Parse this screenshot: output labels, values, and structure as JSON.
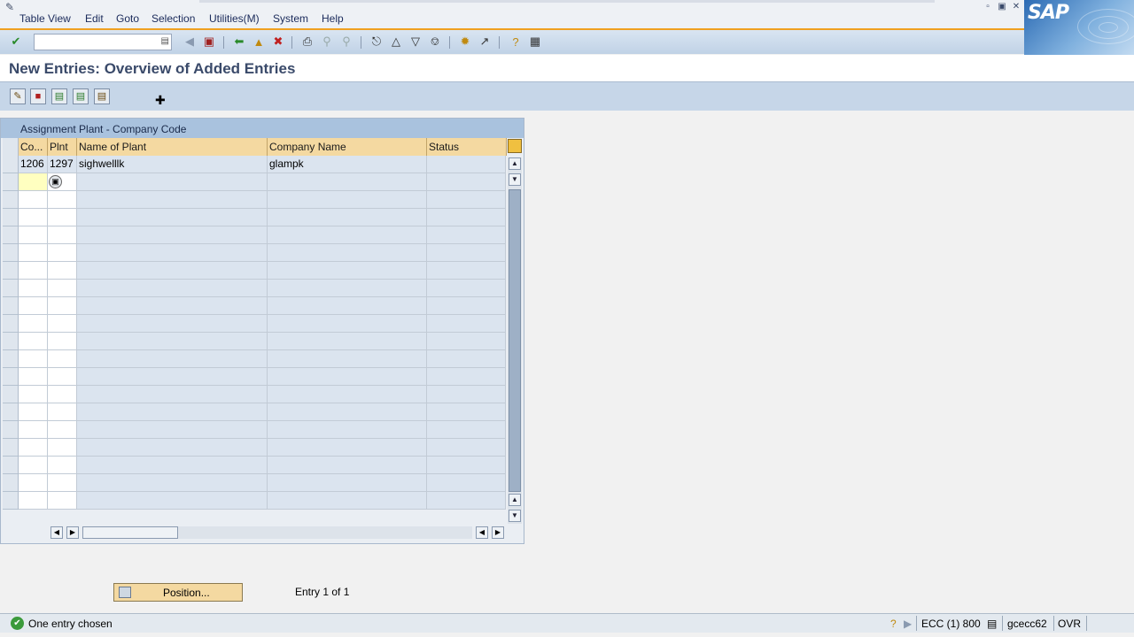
{
  "menu": {
    "items": [
      "Table View",
      "Edit",
      "Goto",
      "Selection",
      "Utilities(M)",
      "System",
      "Help"
    ]
  },
  "brand": {
    "logo_text": "SAP"
  },
  "toolbar": {
    "command_field_value": "",
    "icons": [
      "enter-icon",
      "back-icon",
      "exit-icon",
      "cancel-icon",
      "print-icon",
      "find-icon",
      "find-next-icon",
      "first-page-icon",
      "previous-page-icon",
      "next-page-icon",
      "last-page-icon",
      "create-session-icon",
      "shortcut-icon",
      "help-icon",
      "layout-icon"
    ]
  },
  "page": {
    "title": "New Entries: Overview of Added Entries"
  },
  "app_toolbar": {
    "icons": [
      "change-display-icon",
      "delete-icon",
      "previous-entry-icon",
      "next-entry-icon",
      "select-all-icon"
    ]
  },
  "table": {
    "title": "Assignment Plant - Company Code",
    "columns": [
      "Co...",
      "Plnt",
      "Name of Plant",
      "Company Name",
      "Status"
    ],
    "rows": [
      {
        "company_code": "1206",
        "plant": "1297",
        "name_of_plant": "sighwelllk",
        "company_name": "glampk",
        "status": ""
      }
    ]
  },
  "position_button": {
    "label": "Position..."
  },
  "entry_info": "Entry 1 of 1",
  "status_bar": {
    "message": "One entry chosen",
    "system": "ECC (1) 800",
    "server": "gcecc62",
    "mode": "OVR"
  },
  "colors": {
    "header_orange": "#f4d9a1",
    "toolbar_blue": "#c6d6e8",
    "title_text": "#3a4a6a"
  }
}
